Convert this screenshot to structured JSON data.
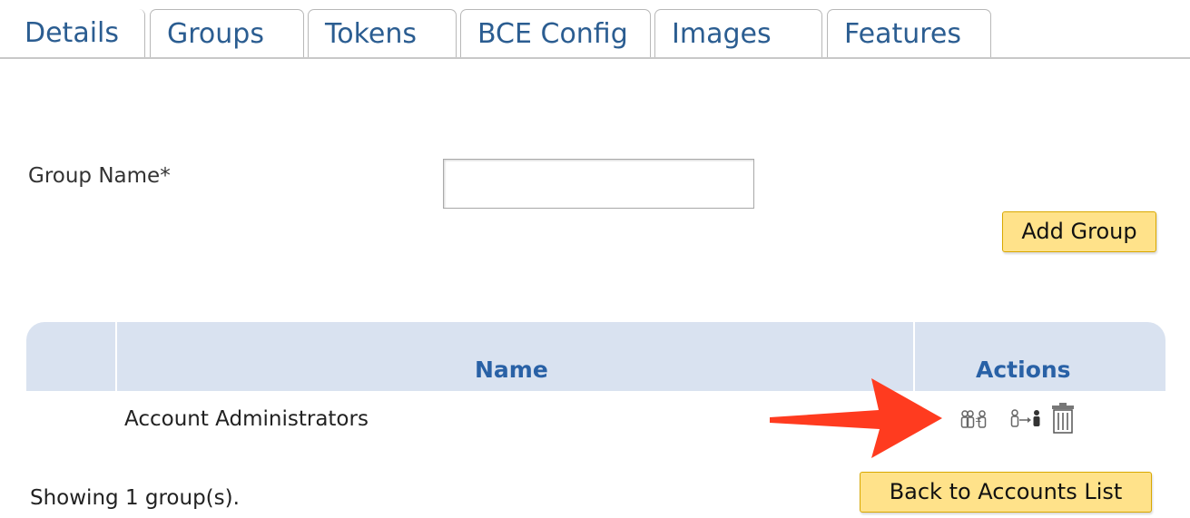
{
  "tabs": [
    {
      "label": "Details"
    },
    {
      "label": "Groups"
    },
    {
      "label": "Tokens"
    },
    {
      "label": "BCE Config"
    },
    {
      "label": "Images"
    },
    {
      "label": "Features"
    }
  ],
  "active_tab": "Groups",
  "form": {
    "group_name_label": "Group Name*",
    "group_name_value": "",
    "add_button": "Add Group"
  },
  "table": {
    "headers": {
      "name": "Name",
      "actions": "Actions"
    },
    "rows": [
      {
        "name": "Account Administrators",
        "actions": [
          "edit-members-icon",
          "transfer-user-icon",
          "delete-icon"
        ]
      }
    ]
  },
  "footer": {
    "status": "Showing 1 group(s).",
    "back_button": "Back to Accounts List"
  },
  "colors": {
    "tab_text": "#2b5d91",
    "header_bg": "#d9e2f0",
    "header_text": "#2961a6",
    "button_bg": "#ffe28a",
    "button_border": "#d9a800",
    "arrow": "#ff3b1f"
  }
}
